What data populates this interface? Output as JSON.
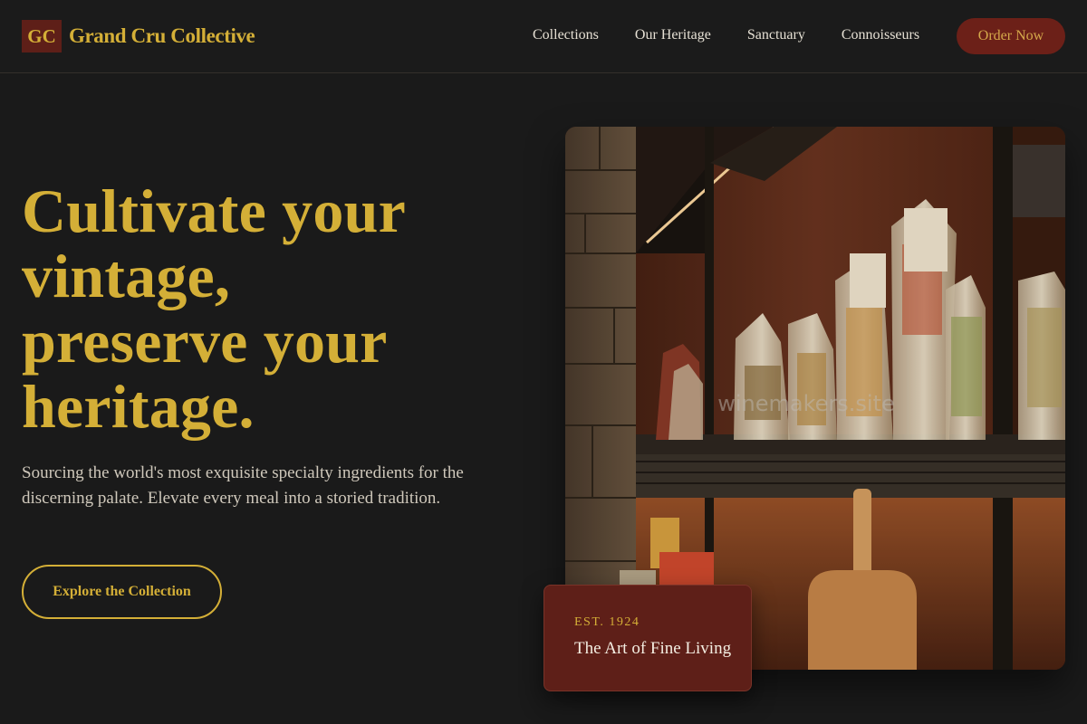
{
  "header": {
    "logo_mark": "GC",
    "brand_name": "Grand Cru Collective",
    "nav": [
      "Collections",
      "Our Heritage",
      "Sanctuary",
      "Connoisseurs"
    ],
    "cta_label": "Order Now"
  },
  "hero": {
    "heading_lines": [
      "Cultivate your",
      "vintage,",
      "preserve your",
      "heritage."
    ],
    "subtext": "Sourcing the world's most exquisite specialty ingredients for the discerning palate. Elevate every meal into a storied tradition.",
    "button_label": "Explore the Collection",
    "image_watermark": "winemakers.site"
  },
  "badge": {
    "label": "EST. 1924",
    "title": "The Art of Fine Living"
  },
  "colors": {
    "background": "#1a1a1a",
    "gold": "#d4af37",
    "wine": "#6c2018"
  }
}
